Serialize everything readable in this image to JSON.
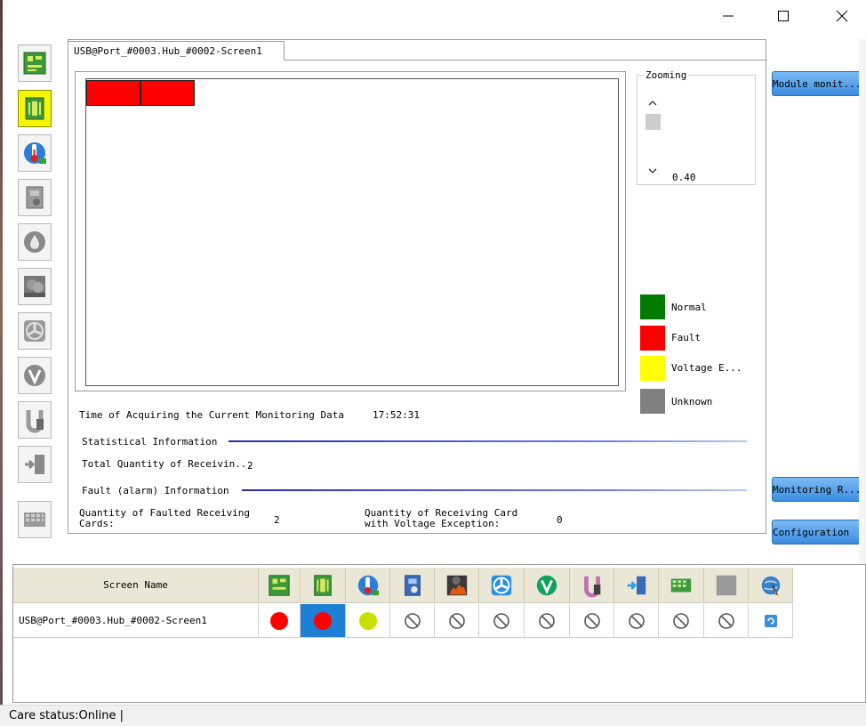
{
  "window": {
    "minimize_icon": "minimize-icon",
    "maximize_icon": "maximize-icon",
    "close_icon": "close-icon"
  },
  "toolbar": {
    "items": [
      {
        "name": "receiving-card",
        "icon": "receiving-card-icon",
        "active": false
      },
      {
        "name": "module",
        "icon": "module-board-icon",
        "active": true
      },
      {
        "name": "temperature",
        "icon": "thermometer-icon",
        "active": false
      },
      {
        "name": "monitor-card",
        "icon": "monitor-card-icon",
        "active": false
      },
      {
        "name": "humidity",
        "icon": "humidity-drop-icon",
        "active": false
      },
      {
        "name": "smoke",
        "icon": "smoke-icon",
        "active": false
      },
      {
        "name": "fan",
        "icon": "fan-icon",
        "active": false
      },
      {
        "name": "voltage",
        "icon": "voltage-icon",
        "active": false
      },
      {
        "name": "cable",
        "icon": "cable-icon",
        "active": false
      },
      {
        "name": "door",
        "icon": "door-icon",
        "active": false
      },
      {
        "name": "pixel",
        "icon": "pixel-grid-icon",
        "active": false
      }
    ]
  },
  "main": {
    "tab_label": "USB@Port_#0003.Hub_#0002-Screen1",
    "zoom": {
      "title": "Zooming",
      "value": "0.40"
    },
    "legend": [
      {
        "label": "Normal",
        "color": "#007a00"
      },
      {
        "label": "Fault",
        "color": "#ff0000"
      },
      {
        "label": "Voltage E...",
        "color": "#ffff00"
      },
      {
        "label": "Unknown",
        "color": "#808080"
      }
    ],
    "acquire_time_label": "Time of Acquiring the Current Monitoring Data",
    "acquire_time_value": "17:52:31",
    "stat_section": "Statistical Information",
    "total_label": "Total Quantity of Receivin...",
    "total_value": "2",
    "fault_section": "Fault (alarm) Information",
    "faulted_label_1": "Quantity of Faulted Receiving",
    "faulted_label_2": "Cards:",
    "faulted_value": "2",
    "voltage_label_1": "Quantity of Receiving Card",
    "voltage_label_2": "with Voltage Exception:",
    "voltage_value": "0"
  },
  "side_buttons": {
    "module_monitor": "Module monit...",
    "monitoring_record": "Monitoring R...",
    "configuration": "Configuration"
  },
  "table": {
    "header_screen_name": "Screen Name",
    "rows": [
      {
        "screen_name": "USB@Port_#0003.Hub_#0002-Screen1",
        "statuses": [
          "fault",
          "fault",
          "voltage",
          "none",
          "none",
          "none",
          "none",
          "none",
          "none",
          "none",
          "none",
          "refresh"
        ]
      }
    ]
  },
  "status": {
    "text": "Care status:Online  |"
  },
  "colors": {
    "fault": "#ff0000",
    "voltage": "#c8e000",
    "selected_cell": "#1e7fd6",
    "active_tool": "#f6f600"
  }
}
